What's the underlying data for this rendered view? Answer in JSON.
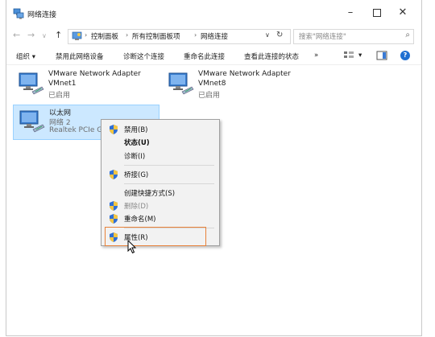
{
  "window": {
    "title": "网络连接",
    "controls": {
      "minimize": "–",
      "maximize": "",
      "close": "✕"
    }
  },
  "nav": {
    "back": "←",
    "forward": "→",
    "recent": "∨",
    "up": "↑"
  },
  "address": {
    "sep": "›",
    "crumbs": [
      "控制面板",
      "所有控制面板项",
      "网络连接"
    ],
    "dropdown": "∨",
    "refresh": "↻"
  },
  "search": {
    "placeholder": "搜索\"网络连接\"",
    "icon": "⌕"
  },
  "commands": {
    "organize": "组织 ▾",
    "disable": "禁用此网络设备",
    "diagnose": "诊断这个连接",
    "rename": "重命名此连接",
    "status": "查看此连接的状态",
    "more": "»",
    "view_dd": "▾",
    "help": "?"
  },
  "adapters": [
    {
      "name": "VMware Network Adapter",
      "line2": "VMnet1",
      "line3": "已启用"
    },
    {
      "name": "VMware Network Adapter",
      "line2": "VMnet8",
      "line3": "已启用"
    },
    {
      "name": "以太网",
      "line2": "网络 2",
      "line3": "Realtek PCIe G"
    }
  ],
  "context_menu": {
    "disable": "禁用(B)",
    "status": "状态(U)",
    "diagnose": "诊断(I)",
    "bridge": "桥接(G)",
    "shortcut": "创建快捷方式(S)",
    "delete": "删除(D)",
    "rename": "重命名(M)",
    "properties": "属性(R)"
  },
  "colors": {
    "selection": "#cce8ff",
    "highlight_border": "#e8823a",
    "accent": "#1f6fd1"
  }
}
